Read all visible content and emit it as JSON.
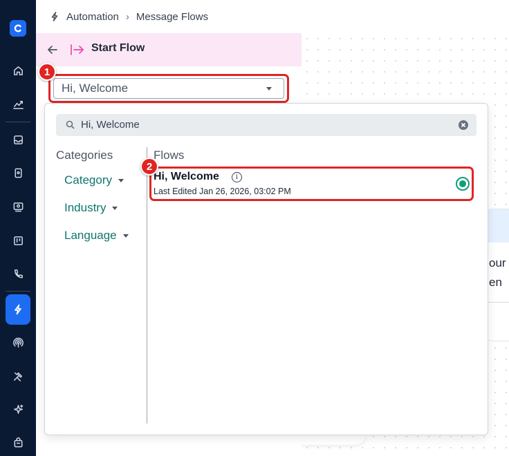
{
  "breadcrumb": {
    "section": "Automation",
    "page": "Message Flows"
  },
  "panel": {
    "title": "Start Flow",
    "selected_flow": "Hi, Welcome"
  },
  "search": {
    "value": "Hi, Welcome"
  },
  "categories": {
    "heading": "Categories",
    "items": [
      {
        "label": "Category"
      },
      {
        "label": "Industry"
      },
      {
        "label": "Language"
      }
    ]
  },
  "flows": {
    "heading": "Flows",
    "items": [
      {
        "name": "Hi, Welcome",
        "meta": "Last Edited Jan 26, 2026, 03:02 PM",
        "selected": true
      }
    ]
  },
  "canvas": {
    "card_line_1": "our",
    "card_line_2": "en"
  },
  "annotations": {
    "marker_1": "1",
    "marker_2": "2"
  },
  "colors": {
    "sidebar": "#0b1a33",
    "accent": "#1d6cf2",
    "highlight": "#e02424",
    "teal": "#0f766e",
    "header_pink": "#fbe7f5"
  }
}
